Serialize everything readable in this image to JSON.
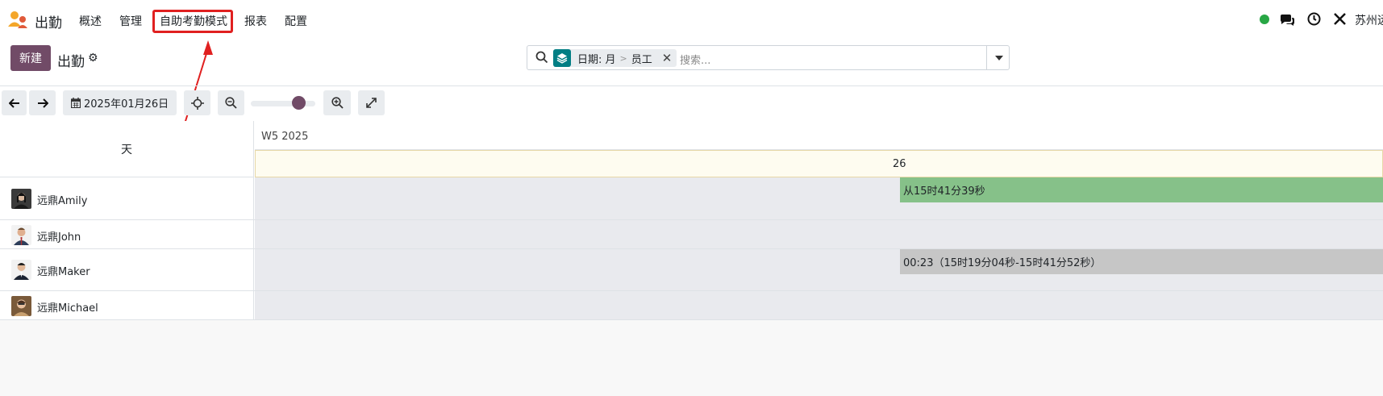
{
  "app": {
    "name": "出勤"
  },
  "menu": [
    {
      "label": "概述"
    },
    {
      "label": "管理"
    },
    {
      "label": "自助考勤模式"
    },
    {
      "label": "报表"
    },
    {
      "label": "配置"
    }
  ],
  "systray": {
    "company": "苏州远",
    "status_color": "#28a745"
  },
  "control": {
    "new_label": "新建",
    "title": "出勤",
    "search": {
      "facet_part1": "日期: 月",
      "facet_sep": ">",
      "facet_part2": "员工",
      "placeholder": "搜索..."
    }
  },
  "toolbar": {
    "date_label": "2025年01月26日",
    "zoom_level": 0.65
  },
  "gantt": {
    "group_header": "天",
    "week_label": "W5 2025",
    "day_label": "26",
    "rows": [
      {
        "name": "远鼎Amily",
        "pill": "从15时41分39秒",
        "pill_color": "#86c189"
      },
      {
        "name": "远鼎John",
        "pill": ""
      },
      {
        "name": "远鼎Maker",
        "pill": "00:23（15时19分04秒-15时41分52秒）",
        "pill_color": "#c6c6c6"
      },
      {
        "name": "远鼎Michael",
        "pill": ""
      }
    ]
  },
  "colors": {
    "brand": "#714b67",
    "facet": "#017e84",
    "highlight": "#e02020"
  }
}
